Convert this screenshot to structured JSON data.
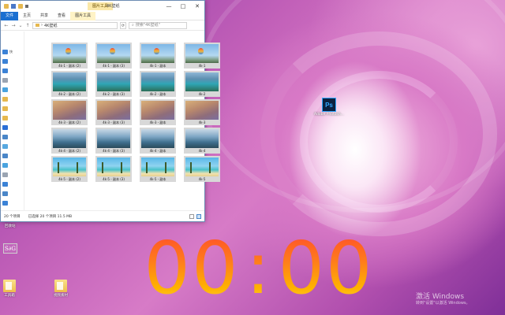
{
  "explorer": {
    "manage_tab": "图片工具",
    "title": "4K壁纸",
    "window_buttons": {
      "minimize": "—",
      "maximize": "□",
      "close": "✕"
    },
    "ribbon_tabs": [
      "文件",
      "主页",
      "共享",
      "查看",
      "图片工具"
    ],
    "address": "4K壁纸",
    "search_placeholder": "搜索\"4K壁纸\"",
    "nav": [
      {
        "label": "快",
        "icon": "star-icon",
        "color": "#3b82d6"
      },
      {
        "label": "",
        "icon": "desktop-icon",
        "color": "#3b82d6"
      },
      {
        "label": "",
        "icon": "download-icon",
        "color": "#3b82d6"
      },
      {
        "label": "",
        "icon": "document-icon",
        "color": "#9aa4b2"
      },
      {
        "label": "",
        "icon": "picture-icon",
        "color": "#4aa3df"
      },
      {
        "label": "",
        "icon": "folder-icon",
        "color": "#e6b84f"
      },
      {
        "label": "",
        "icon": "folder-icon",
        "color": "#e6b84f"
      },
      {
        "label": "",
        "icon": "folder-icon",
        "color": "#e6b84f"
      },
      {
        "label": "",
        "icon": "onedrive-icon",
        "color": "#2b6fd6"
      },
      {
        "label": "",
        "icon": "this-pc-icon",
        "color": "#4a86c8"
      },
      {
        "label": "",
        "icon": "cube-icon",
        "color": "#57a8e0"
      },
      {
        "label": "",
        "icon": "video-icon",
        "color": "#4a86c8"
      },
      {
        "label": "",
        "icon": "picture-icon",
        "color": "#4aa3df"
      },
      {
        "label": "",
        "icon": "document-icon",
        "color": "#9aa4b2"
      },
      {
        "label": "",
        "icon": "download-icon",
        "color": "#3b82d6"
      },
      {
        "label": "",
        "icon": "music-icon",
        "color": "#4a86c8"
      },
      {
        "label": "",
        "icon": "desktop-icon",
        "color": "#3b82d6"
      }
    ],
    "thumbnails": [
      [
        {
          "label": "4k-1 - 副本 (2)",
          "kind": "balloon"
        },
        {
          "label": "4k-1 - 副本 (3)",
          "kind": "balloon"
        },
        {
          "label": "4k-1 - 副本",
          "kind": "balloon"
        },
        {
          "label": "4k-1",
          "kind": "balloon"
        }
      ],
      [
        {
          "label": "4k-2 - 副本 (2)",
          "kind": "lake"
        },
        {
          "label": "4k-2 - 副本 (3)",
          "kind": "lake"
        },
        {
          "label": "4k-2 - 副本",
          "kind": "lake"
        },
        {
          "label": "4k-2",
          "kind": "lake"
        }
      ],
      [
        {
          "label": "4k-3 - 副本 (2)",
          "kind": "rock"
        },
        {
          "label": "4k-3 - 副本 (3)",
          "kind": "rock"
        },
        {
          "label": "4k-3 - 副本",
          "kind": "rock"
        },
        {
          "label": "4k-3",
          "kind": "rock"
        }
      ],
      [
        {
          "label": "4k-4 - 副本 (2)",
          "kind": "fjord"
        },
        {
          "label": "4k-4 - 副本 (3)",
          "kind": "fjord"
        },
        {
          "label": "4k-4 - 副本",
          "kind": "fjord"
        },
        {
          "label": "4k-4",
          "kind": "fjord"
        }
      ],
      [
        {
          "label": "4k-5 - 副本 (2)",
          "kind": "beach"
        },
        {
          "label": "4k-5 - 副本 (3)",
          "kind": "beach"
        },
        {
          "label": "4k-5 - 副本",
          "kind": "beach"
        },
        {
          "label": "4k-5",
          "kind": "beach"
        }
      ]
    ],
    "status": {
      "count": "20 个项目",
      "selected": "已选择 20 个项目  11.5 MB"
    }
  },
  "desktop_icons": {
    "photoshop": {
      "tile": "Ps",
      "label": "Adobe Photosh..."
    },
    "sg": {
      "tile": "S∂G",
      "label": ""
    },
    "folder1": {
      "label": "工具箱"
    },
    "folder2": {
      "label": "视频素材"
    },
    "top_left_label": "回收站"
  },
  "timer": {
    "minutes": "00",
    "separator": ":",
    "seconds": "00"
  },
  "watermark": {
    "line1": "激活 Windows",
    "line2": "转到\"设置\"以激活 Windows。"
  }
}
